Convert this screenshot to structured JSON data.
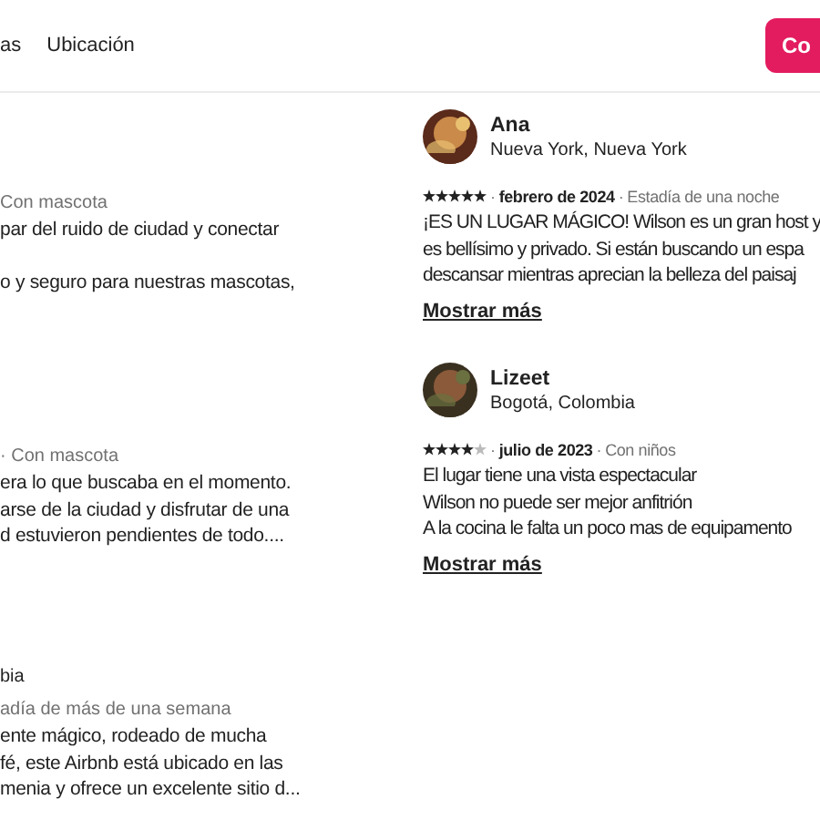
{
  "nav": {
    "tabs": [
      {
        "label": "as"
      },
      {
        "label": "Ubicación"
      }
    ],
    "action_button": {
      "label": "Co"
    }
  },
  "left_reviews": [
    {
      "meta": "Con mascota",
      "paragraphs": [
        [
          "par del ruido de ciudad y conectar"
        ],
        [
          "o y seguro para nuestras mascotas,"
        ]
      ]
    },
    {
      "meta": "· Con mascota",
      "paragraphs": [
        [
          "era lo que buscaba en el momento.",
          "arse de la ciudad y disfrutar de una",
          "d estuvieron pendientes de todo...."
        ]
      ]
    },
    {
      "location": "bia",
      "meta": "adía de más de una semana",
      "paragraphs": [
        [
          "ente mágico, rodeado de mucha",
          "fé, este Airbnb está ubicado en las",
          "menia y ofrece un excelente sitio d..."
        ]
      ]
    }
  ],
  "right_reviews": [
    {
      "name": "Ana",
      "location": "Nueva York, Nueva York",
      "stars": 5,
      "separator": "·",
      "date": "febrero de 2024",
      "stay": "Estadía de una noche",
      "lines": [
        "¡ES UN LUGAR MÁGICO! Wilson es un gran host y",
        "es bellísimo y privado. Si están buscando un espa",
        "descansar mientras aprecian la belleza del paisaj"
      ],
      "more": "Mostrar más"
    },
    {
      "name": "Lizeet",
      "location": "Bogotá, Colombia",
      "stars": 4,
      "separator": "·",
      "date": "julio de 2023",
      "stay": "Con niños",
      "lines": [
        "El lugar tiene una vista espectacular",
        "Wilson no puede ser mejor anfitrión",
        "A la cocina le falta un poco mas de equipamento"
      ],
      "more": "Mostrar más"
    }
  ]
}
